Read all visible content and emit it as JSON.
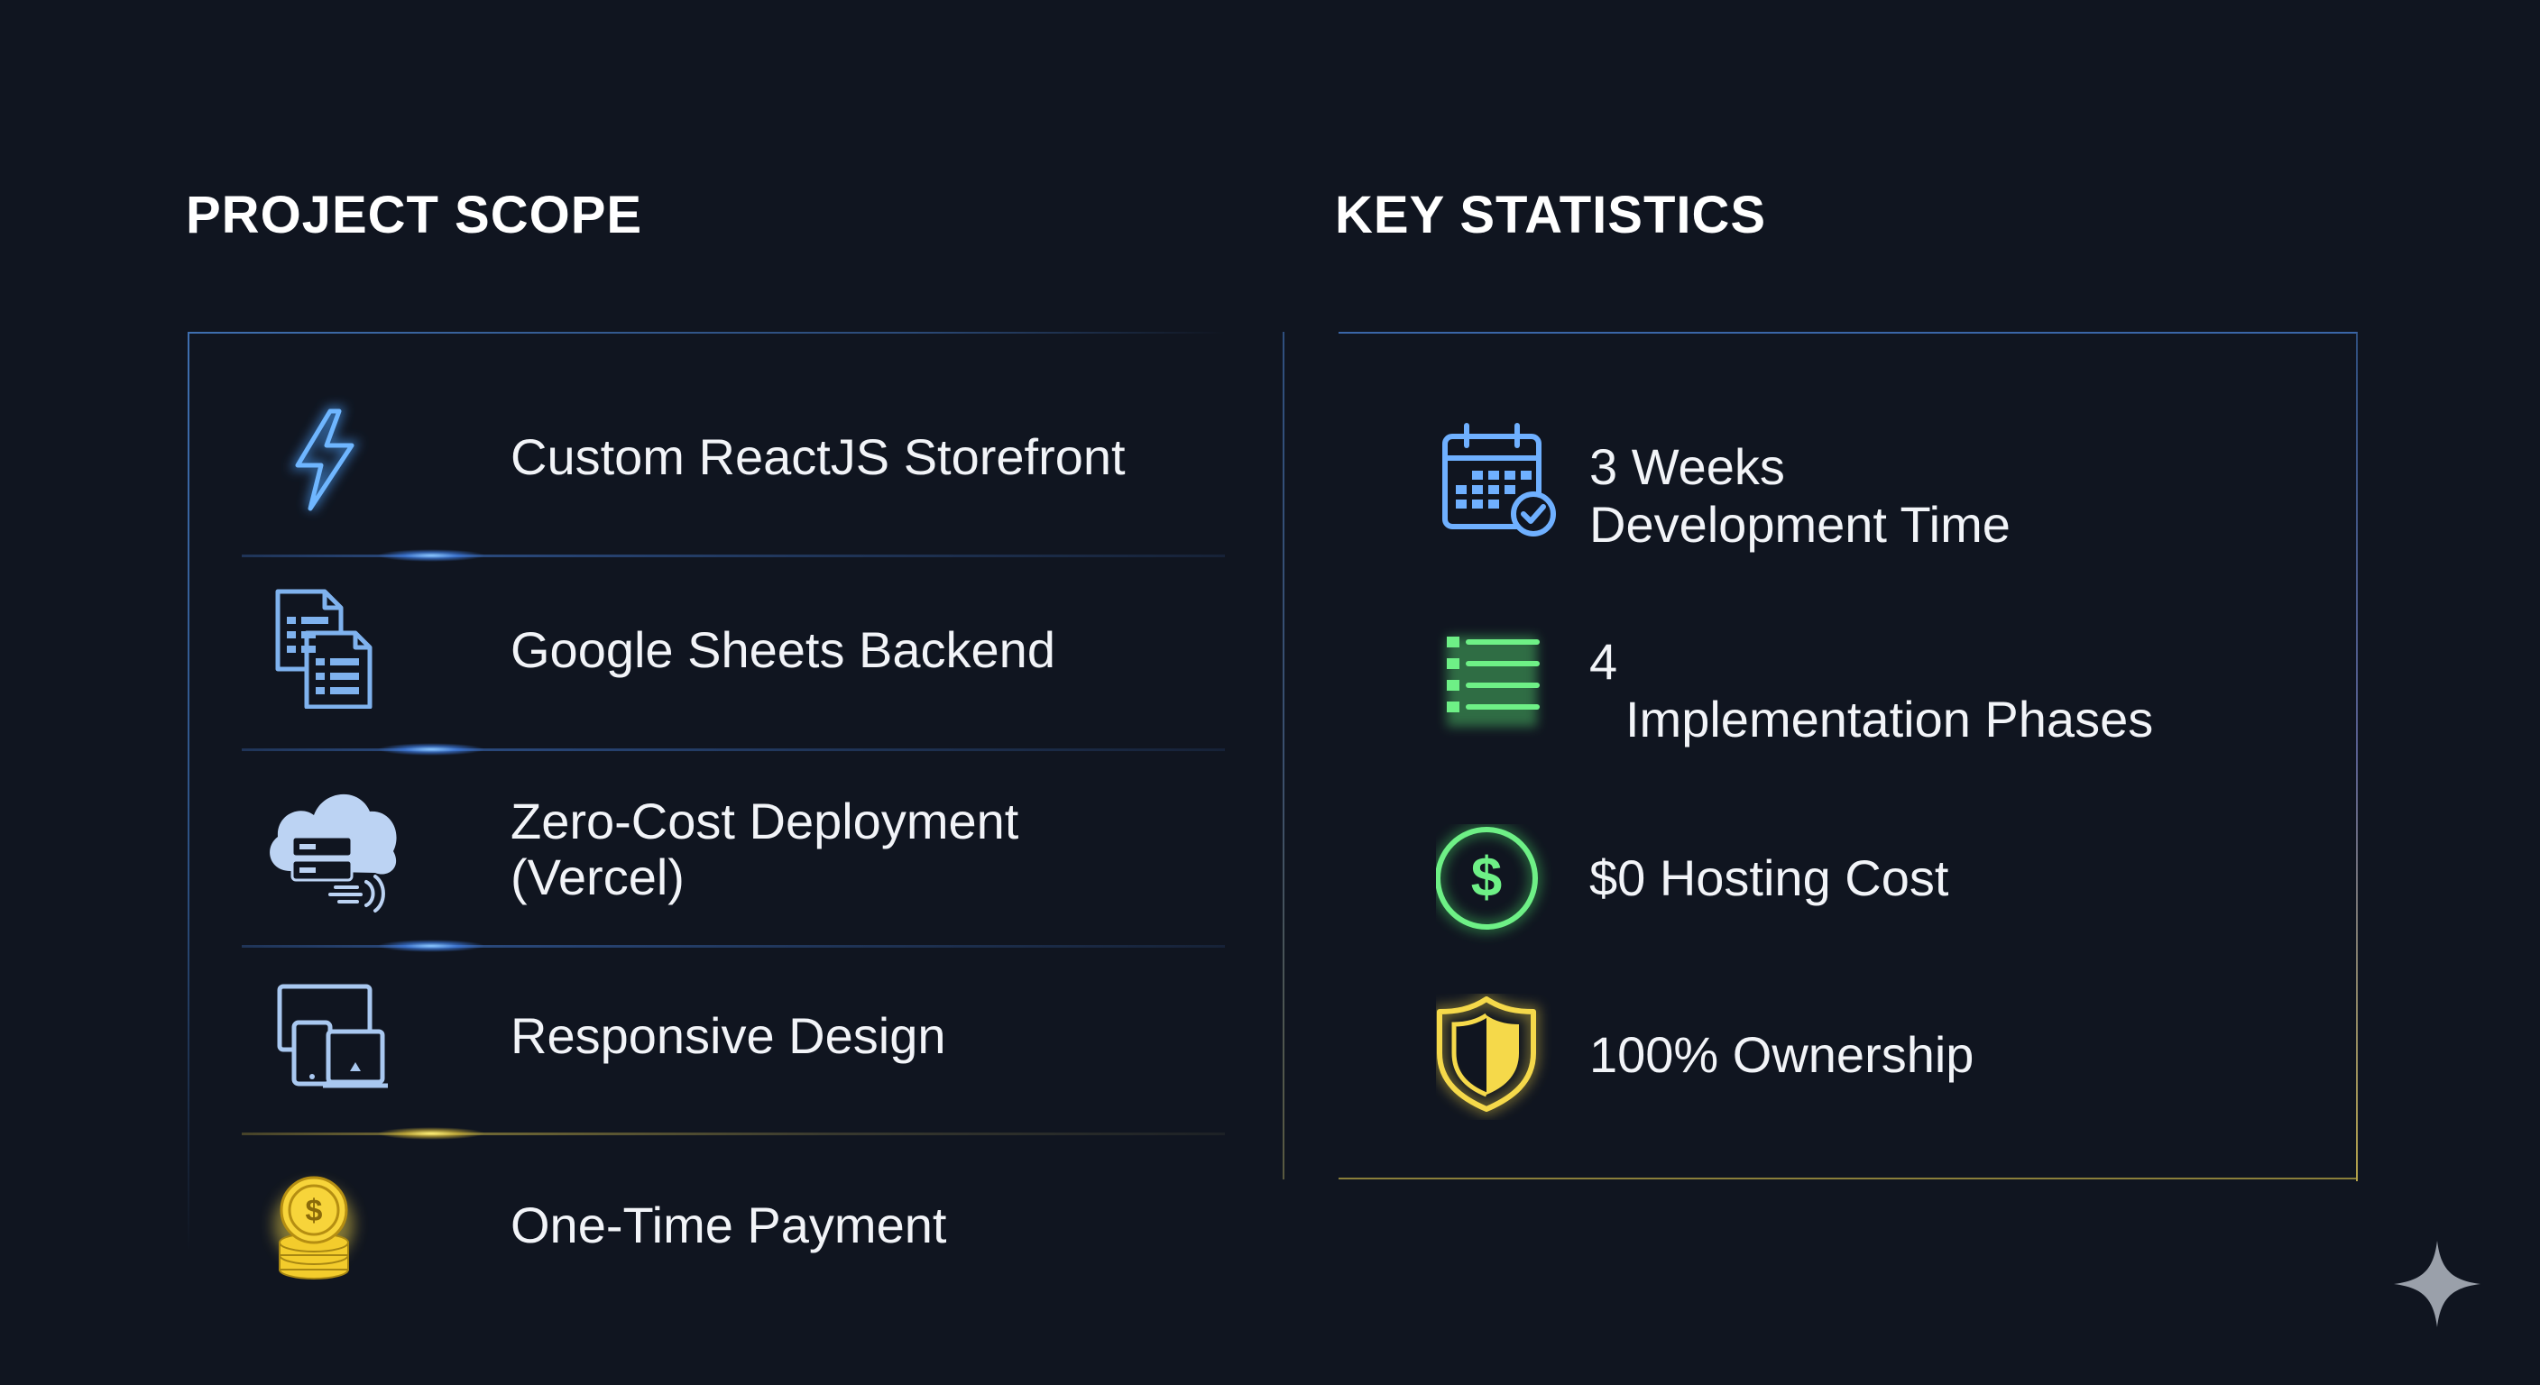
{
  "project_scope": {
    "title": "PROJECT SCOPE",
    "items": [
      {
        "icon": "lightning-bolt-icon",
        "label": "Custom ReactJS Storefront"
      },
      {
        "icon": "spreadsheet-documents-icon",
        "label": "Google Sheets Backend"
      },
      {
        "icon": "cloud-server-icon",
        "label_line1": "Zero-Cost Deployment",
        "label_line2": "(Vercel)"
      },
      {
        "icon": "devices-icon",
        "label": "Responsive Design"
      },
      {
        "icon": "coin-stack-icon",
        "label": "One-Time Payment"
      }
    ]
  },
  "key_statistics": {
    "title": "KEY STATISTICS",
    "items": [
      {
        "icon": "calendar-check-icon",
        "line1": "3 Weeks",
        "line2": "Development Time"
      },
      {
        "icon": "list-icon",
        "line1": "4",
        "line2": "Implementation Phases"
      },
      {
        "icon": "dollar-circle-icon",
        "line1": "$0 Hosting Cost"
      },
      {
        "icon": "shield-icon",
        "line1": "100% Ownership"
      }
    ]
  },
  "colors": {
    "background": "#101520",
    "accent_blue": "#4da3ff",
    "accent_green": "#4ee86a",
    "accent_gold": "#f5d94a",
    "text": "#f2f4f8"
  },
  "watermark_icon": "sparkle-icon"
}
